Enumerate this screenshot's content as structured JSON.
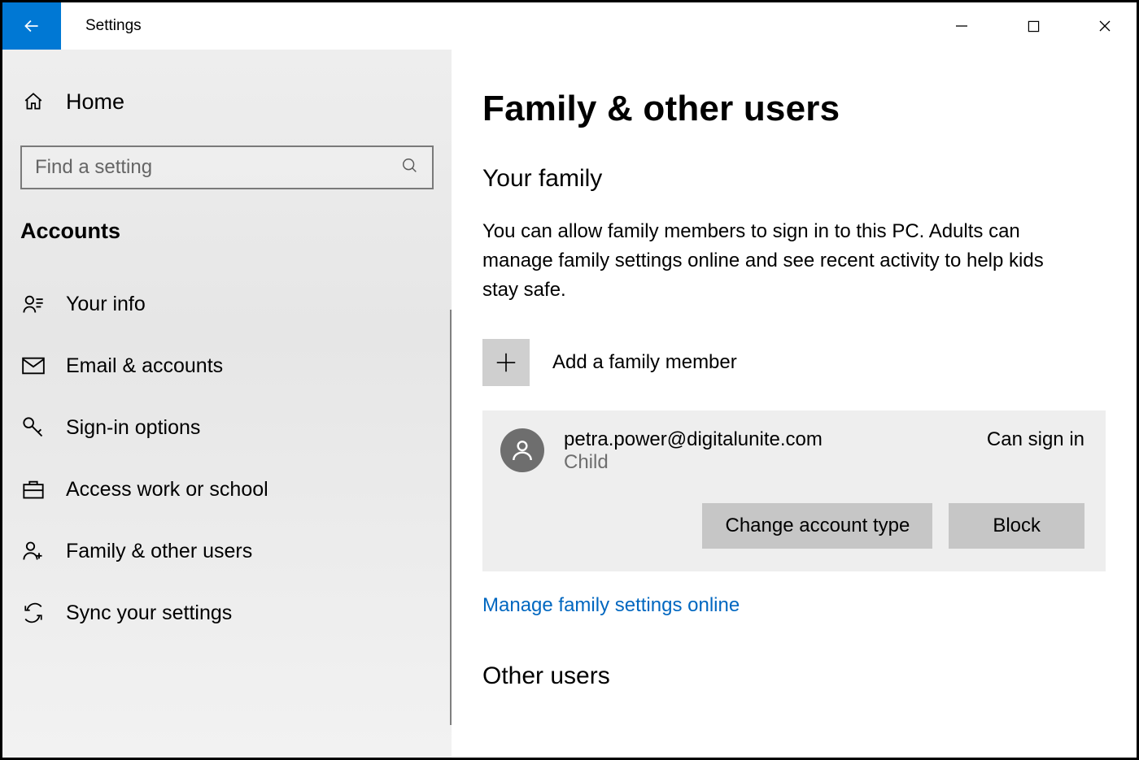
{
  "titlebar": {
    "title": "Settings"
  },
  "sidebar": {
    "home": "Home",
    "search_placeholder": "Find a setting",
    "category": "Accounts",
    "items": [
      {
        "label": "Your info"
      },
      {
        "label": "Email & accounts"
      },
      {
        "label": "Sign-in options"
      },
      {
        "label": "Access work or school"
      },
      {
        "label": "Family & other users"
      },
      {
        "label": "Sync your settings"
      }
    ]
  },
  "main": {
    "page_title": "Family & other users",
    "your_family_heading": "Your family",
    "your_family_description": "You can allow family members to sign in to this PC. Adults can manage family settings online and see recent activity to help kids stay safe.",
    "add_family_label": "Add a family member",
    "member": {
      "email": "petra.power@digitalunite.com",
      "role": "Child",
      "status": "Can sign in",
      "change_type_label": "Change account type",
      "block_label": "Block"
    },
    "manage_link": "Manage family settings online",
    "other_users_heading": "Other users"
  }
}
